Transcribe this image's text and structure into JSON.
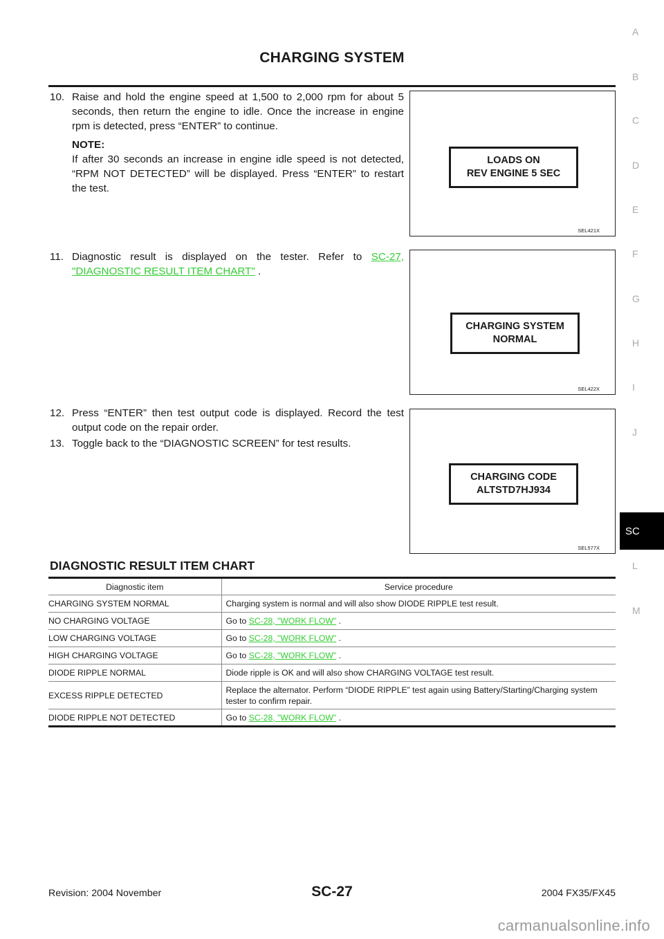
{
  "header": {
    "title": "CHARGING SYSTEM"
  },
  "steps": [
    {
      "number": "10.",
      "text": "Raise and hold the engine speed at 1,500 to 2,000 rpm for about 5 seconds, then return the engine to idle. Once the increase in engine rpm is detected, press “ENTER” to continue.",
      "note_label": "NOTE:",
      "note_text": "If after 30 seconds an increase in engine idle speed is not detected, “RPM NOT DETECTED” will be displayed. Press “ENTER” to restart the test."
    },
    {
      "number": "11.",
      "text_before": "Diagnostic result is displayed on the tester. Refer to ",
      "link_text": "SC-27, \"DIAGNOSTIC RESULT ITEM CHART\"",
      "text_after": " ."
    },
    {
      "number": "12.",
      "text": "Press “ENTER” then test output code is displayed. Record the test output code on the repair order."
    },
    {
      "number": "13.",
      "text": "Toggle back to the “DIAGNOSTIC SCREEN” for test results."
    }
  ],
  "figures": [
    {
      "line1": "LOADS ON",
      "line2": "REV ENGINE 5 SEC",
      "id": "SEL421X"
    },
    {
      "line1": "CHARGING SYSTEM",
      "line2": "NORMAL",
      "id": "SEL422X"
    },
    {
      "line1": "CHARGING CODE",
      "line2": "ALTSTD7HJ934",
      "id": "SEL577X"
    }
  ],
  "section": {
    "title": "DIAGNOSTIC RESULT ITEM CHART"
  },
  "table": {
    "headers": [
      "Diagnostic item",
      "Service procedure"
    ],
    "rows": [
      {
        "item": "CHARGING SYSTEM NORMAL",
        "procedure": "Charging system is normal and will also show DIODE RIPPLE test result."
      },
      {
        "item": "NO CHARGING VOLTAGE",
        "prefix": "Go to ",
        "link": "SC-28, \"WORK FLOW\"",
        "suffix": " ."
      },
      {
        "item": "LOW CHARGING VOLTAGE",
        "prefix": "Go to ",
        "link": "SC-28, \"WORK FLOW\"",
        "suffix": " ."
      },
      {
        "item": "HIGH CHARGING VOLTAGE",
        "prefix": "Go to ",
        "link": "SC-28, \"WORK FLOW\"",
        "suffix": " ."
      },
      {
        "item": "DIODE RIPPLE NORMAL",
        "procedure": "Diode ripple is OK and will also show CHARGING VOLTAGE test result."
      },
      {
        "item": "EXCESS RIPPLE DETECTED",
        "procedure": "Replace the alternator. Perform “DIODE RIPPLE” test again using Battery/Starting/Charging system tester to confirm repair."
      },
      {
        "item": "DIODE RIPPLE NOT DETECTED",
        "prefix": "Go to ",
        "link": "SC-28, \"WORK FLOW\"",
        "suffix": " ."
      }
    ]
  },
  "side_index": {
    "tabs": [
      "A",
      "B",
      "C",
      "D",
      "E",
      "F",
      "G",
      "H",
      "I",
      "J",
      "SC",
      "L",
      "M"
    ],
    "active": "SC"
  },
  "footer": {
    "revision": "Revision: 2004 November",
    "page": "SC-27",
    "model": "2004 FX35/FX45",
    "watermark": "carmanualsonline.info"
  },
  "colors": {
    "link": "#33cc33",
    "text": "#1a1a1a",
    "index_inactive": "#aaaaaa",
    "index_active_bg": "#000000"
  }
}
